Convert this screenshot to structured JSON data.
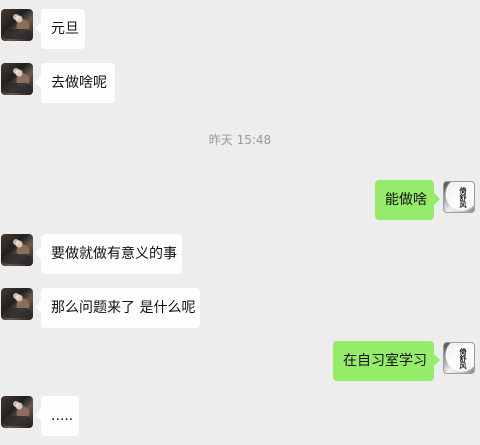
{
  "messages": [
    {
      "side": "left",
      "text": "元旦"
    },
    {
      "side": "left",
      "text": "去做啥呢"
    },
    {
      "side": "right",
      "text": "能做啥"
    },
    {
      "side": "left",
      "text": "要做就做有意义的事"
    },
    {
      "side": "left",
      "text": "那么问题来了 是什么呢"
    },
    {
      "side": "right",
      "text": "在自习室学习"
    },
    {
      "side": "left",
      "text": "....."
    }
  ],
  "timestamp": "昨天 15:48",
  "avatars": {
    "left": {
      "icon": "avatar-photo"
    },
    "right": {
      "icon": "calligraphy-avatar",
      "text": "倚舒风"
    }
  },
  "colors": {
    "background": "#ededed",
    "incoming_bubble": "#fefefe",
    "outgoing_bubble": "#95ec69",
    "timestamp": "#9a9a9a"
  }
}
